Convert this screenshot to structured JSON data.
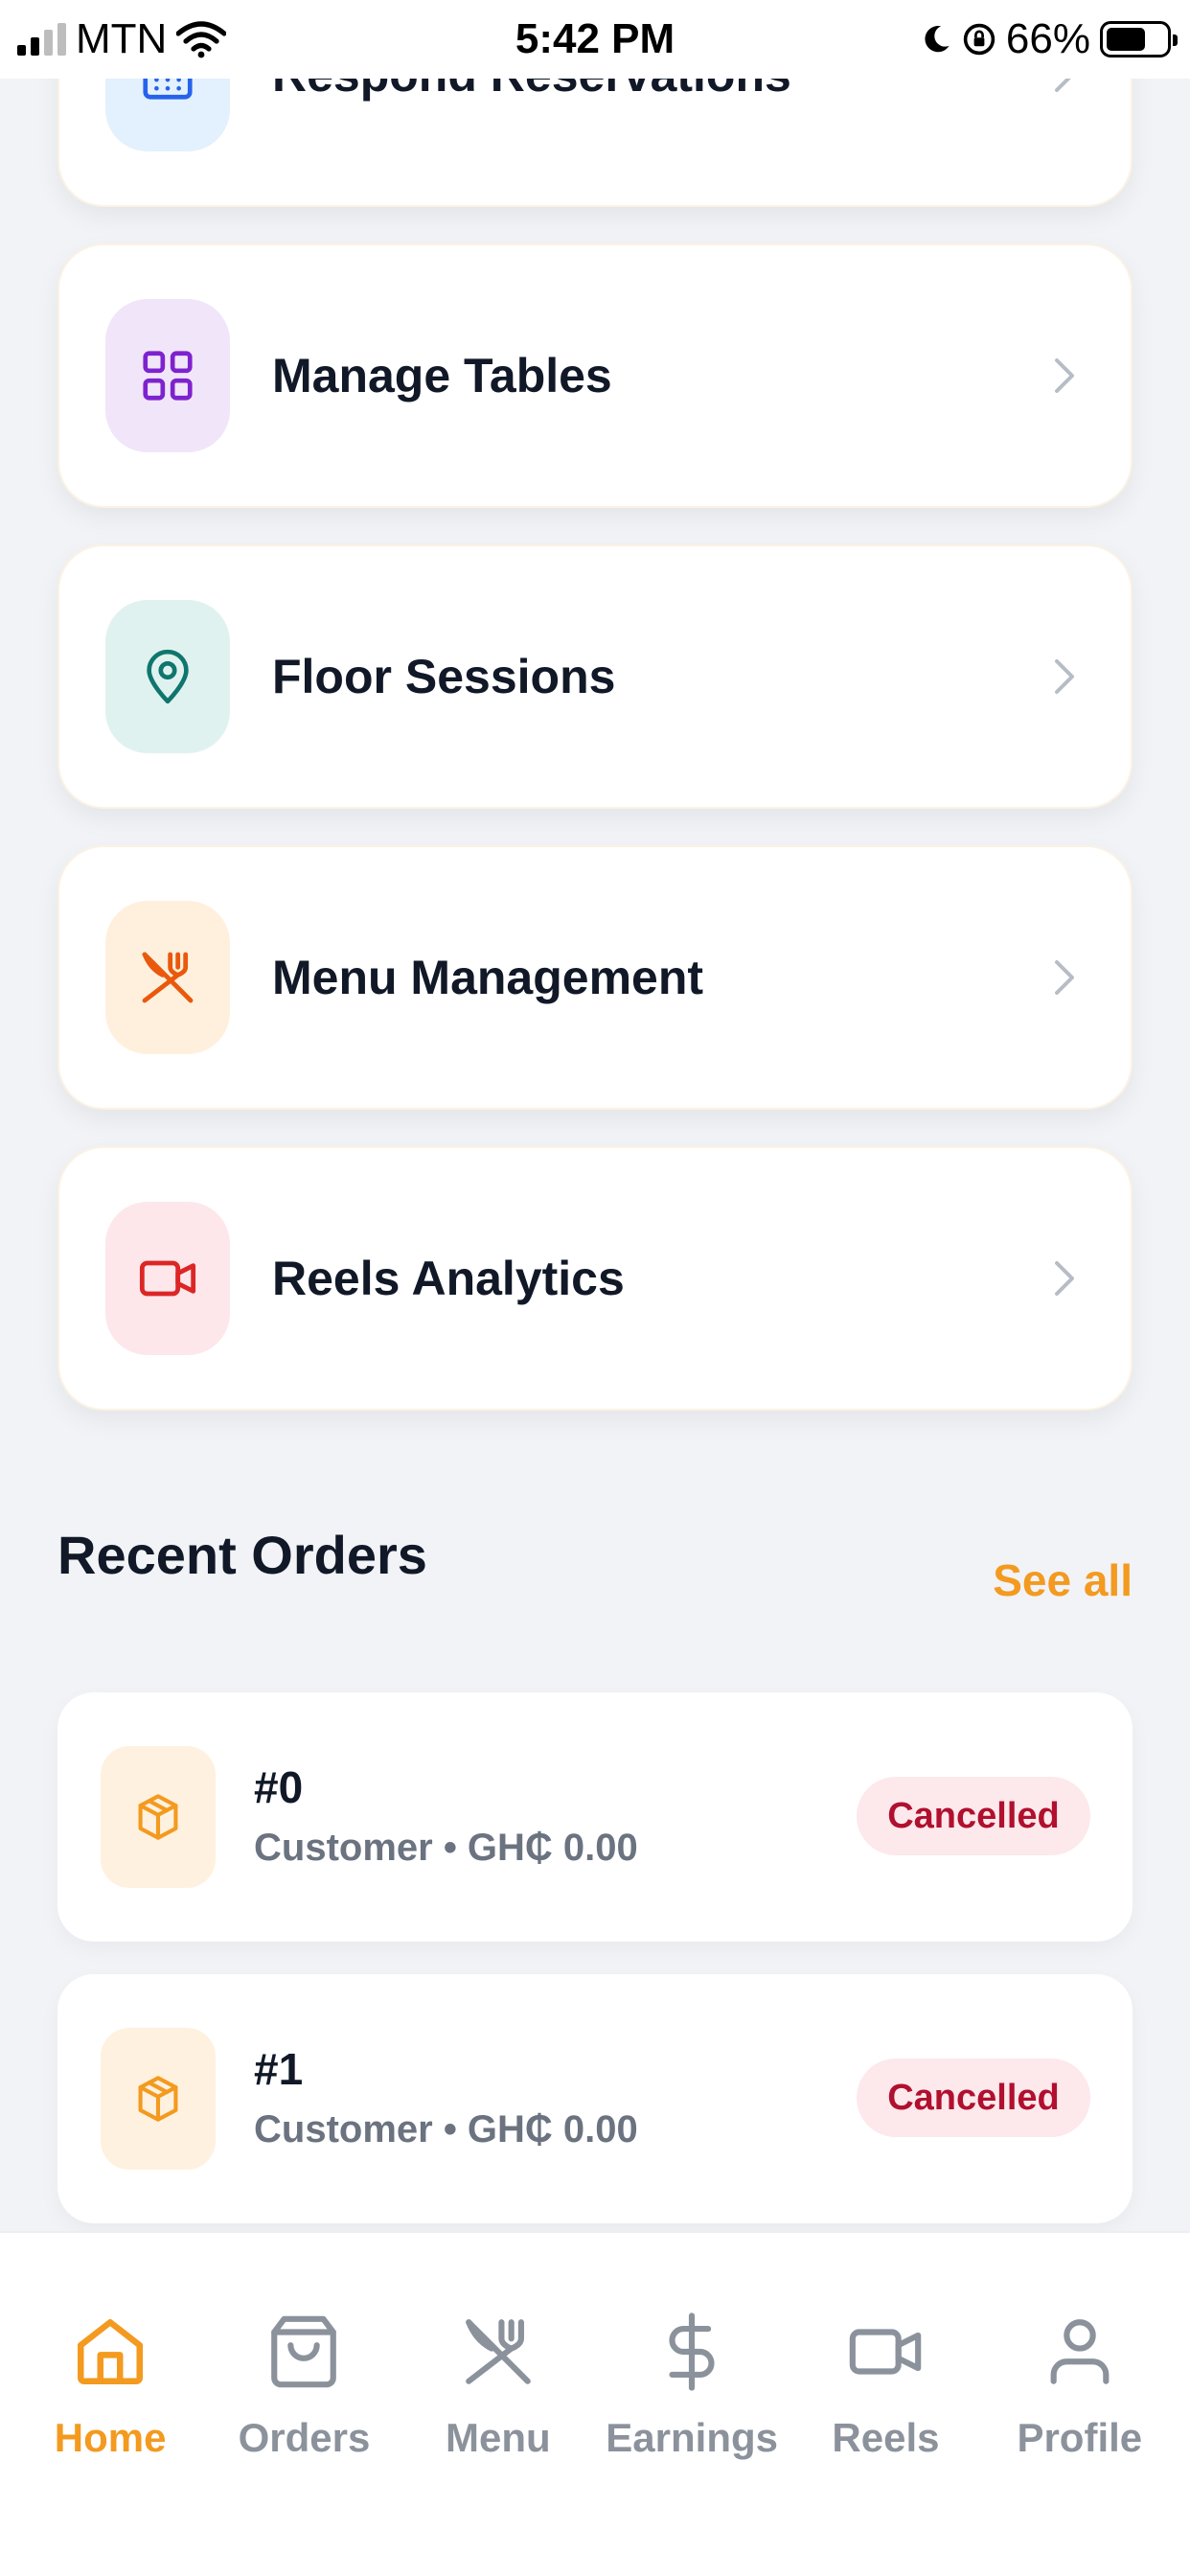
{
  "status_bar": {
    "carrier": "MTN",
    "time": "5:42 PM",
    "battery_percent": "66%",
    "battery_level": 0.66
  },
  "menu_items": [
    {
      "label": "Respond Reservations",
      "icon": "calendar-icon",
      "tint": "#E3F0FD",
      "color": "#2563EB"
    },
    {
      "label": "Manage Tables",
      "icon": "grid-icon",
      "tint": "#F1E5FA",
      "color": "#7E22CE"
    },
    {
      "label": "Floor Sessions",
      "icon": "map-pin-icon",
      "tint": "#E0F2EF",
      "color": "#0F766E"
    },
    {
      "label": "Menu Management",
      "icon": "utensils-icon",
      "tint": "#FFF0DD",
      "color": "#EA580C"
    },
    {
      "label": "Reels Analytics",
      "icon": "video-icon",
      "tint": "#FDE7EA",
      "color": "#DC2626"
    }
  ],
  "recent_orders": {
    "title": "Recent Orders",
    "see_all": "See all",
    "orders": [
      {
        "id": "#0",
        "meta": "Customer • GH₵ 0.00",
        "status": "Cancelled"
      },
      {
        "id": "#1",
        "meta": "Customer • GH₵ 0.00",
        "status": "Cancelled"
      }
    ]
  },
  "bottom_nav": {
    "items": [
      {
        "label": "Home",
        "icon": "home-icon",
        "active": true
      },
      {
        "label": "Orders",
        "icon": "shopping-bag-icon",
        "active": false
      },
      {
        "label": "Menu",
        "icon": "utensils-icon",
        "active": false
      },
      {
        "label": "Earnings",
        "icon": "dollar-icon",
        "active": false
      },
      {
        "label": "Reels",
        "icon": "video-icon",
        "active": false
      },
      {
        "label": "Profile",
        "icon": "user-icon",
        "active": false
      }
    ]
  },
  "colors": {
    "accent": "#F39A1F",
    "background": "#F1F3F6",
    "badge_bg": "#FDE8EC",
    "badge_text": "#B0102E",
    "text_primary": "#111827",
    "text_secondary": "#6B7280",
    "nav_inactive": "#8B929C"
  }
}
